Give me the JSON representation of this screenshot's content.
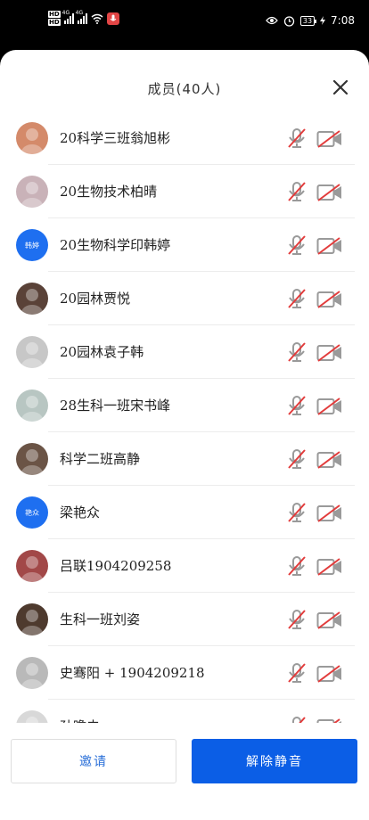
{
  "status_bar": {
    "hd_labels": [
      "HD",
      "HD"
    ],
    "signal_tags": [
      "4G",
      "4G"
    ],
    "battery": "33",
    "time": "7:08"
  },
  "header": {
    "title": "成员(40人)",
    "close_icon": "close-icon"
  },
  "members": [
    {
      "name": "20科学三班翁旭彬",
      "avatar": {
        "type": "photo",
        "color": "#d48a6a"
      }
    },
    {
      "name": "20生物技术柏晴",
      "avatar": {
        "type": "photo",
        "color": "#c9b2b8"
      }
    },
    {
      "name": "20生物科学印韩婷",
      "avatar": {
        "type": "text",
        "text": "韩婷",
        "color": "#1e6ff0"
      }
    },
    {
      "name": "20园林贾悦",
      "avatar": {
        "type": "photo",
        "color": "#5a4238"
      }
    },
    {
      "name": "20园林袁子韩",
      "avatar": {
        "type": "photo",
        "color": "#c7c7c7"
      }
    },
    {
      "name": "28生科一班宋书峰",
      "avatar": {
        "type": "photo",
        "color": "#b8c6c2"
      }
    },
    {
      "name": "科学二班高静",
      "avatar": {
        "type": "photo",
        "color": "#6b5446"
      }
    },
    {
      "name": "梁艳众",
      "avatar": {
        "type": "text",
        "text": "艳众",
        "color": "#1e6ff0"
      }
    },
    {
      "name": "吕联1904209258",
      "avatar": {
        "type": "photo",
        "color": "#a24848"
      }
    },
    {
      "name": "生科一班刘姿",
      "avatar": {
        "type": "photo",
        "color": "#4e3a2e"
      }
    },
    {
      "name": "史骞阳 + 1904209218",
      "avatar": {
        "type": "photo",
        "color": "#b9b9b9"
      }
    },
    {
      "name": "孙瞻未",
      "avatar": {
        "type": "photo",
        "color": "#d8d8d8"
      }
    }
  ],
  "icons": {
    "mic": "mic-muted-icon",
    "camera": "camera-off-icon"
  },
  "colors": {
    "muted_red": "#e23c3c",
    "icon_gray": "#9a9a9a",
    "primary": "#0b5ee6"
  },
  "footer": {
    "invite_label": "邀请",
    "unmute_label": "解除静音"
  }
}
